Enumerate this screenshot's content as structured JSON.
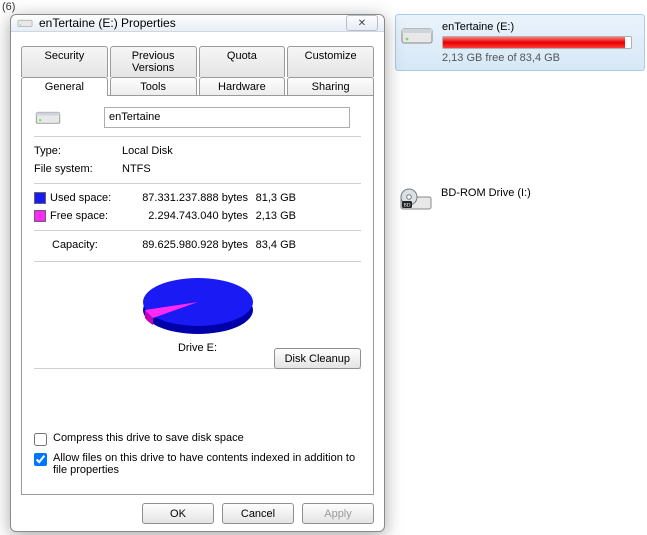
{
  "background": {
    "folder_count_label": "(6)"
  },
  "explorer": {
    "drive1": {
      "title": "enTertaine (E:)",
      "sub": "2,13 GB free of 83,4 GB",
      "fill_percent": 97
    },
    "drive2": {
      "title": "BD-ROM Drive (I:)"
    }
  },
  "dialog": {
    "title": "enTertaine (E:) Properties",
    "close_glyph": "✕",
    "tabs_row1": {
      "security": "Security",
      "previous": "Previous Versions",
      "quota": "Quota",
      "customize": "Customize"
    },
    "tabs_row2": {
      "general": "General",
      "tools": "Tools",
      "hardware": "Hardware",
      "sharing": "Sharing"
    },
    "name_value": "enTertaine",
    "type_label": "Type:",
    "type_value": "Local Disk",
    "fs_label": "File system:",
    "fs_value": "NTFS",
    "used_label": "Used space:",
    "used_bytes": "87.331.237.888 bytes",
    "used_h": "81,3 GB",
    "free_label": "Free space:",
    "free_bytes": "2.294.743.040 bytes",
    "free_h": "2,13 GB",
    "cap_label": "Capacity:",
    "cap_bytes": "89.625.980.928 bytes",
    "cap_h": "83,4 GB",
    "drive_caption": "Drive E:",
    "cleanup_btn": "Disk Cleanup",
    "compress_label": "Compress this drive to save disk space",
    "index_label": "Allow files on this drive to have contents indexed in addition to file properties",
    "ok": "OK",
    "cancel": "Cancel",
    "apply": "Apply"
  },
  "chart_data": {
    "type": "pie",
    "title": "Drive E:",
    "categories": [
      "Used space",
      "Free space"
    ],
    "values": [
      81.3,
      2.13
    ],
    "series_colors": [
      "#1a1af5",
      "#ff29f5"
    ],
    "unit": "GB"
  }
}
